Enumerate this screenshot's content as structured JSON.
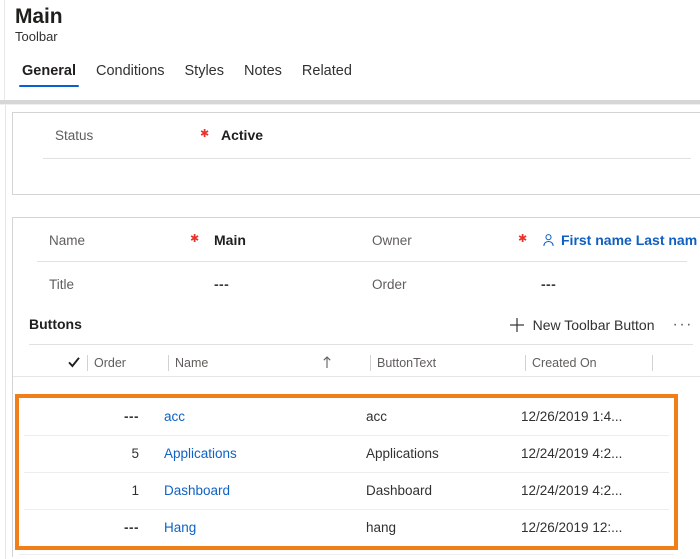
{
  "header": {
    "title": "Main",
    "subtitle": "Toolbar",
    "tabs": [
      {
        "label": "General",
        "active": true
      },
      {
        "label": "Conditions",
        "active": false
      },
      {
        "label": "Styles",
        "active": false
      },
      {
        "label": "Notes",
        "active": false
      },
      {
        "label": "Related",
        "active": false
      }
    ]
  },
  "status_card": {
    "label": "Status",
    "required_marker": "✱",
    "value": "Active"
  },
  "main_card": {
    "rows": [
      {
        "left_label": "Name",
        "left_required": "✱",
        "left_value": "Main",
        "right_label": "Owner",
        "right_required": "✱",
        "right_value": "First name Last nam",
        "right_icon": "person-icon"
      },
      {
        "left_label": "Title",
        "left_required": "",
        "left_value": "---",
        "right_label": "Order",
        "right_required": "",
        "right_value": "---",
        "right_icon": ""
      }
    ]
  },
  "subgrid": {
    "title": "Buttons",
    "new_button_label": "New Toolbar Button",
    "plus_icon": "plus-icon",
    "overflow_label": "···",
    "columns": [
      {
        "label": "Order"
      },
      {
        "label": "Name"
      },
      {
        "label": "ButtonText"
      },
      {
        "label": "Created On"
      }
    ],
    "select_all_icon": "checkmark-icon",
    "sort_icon": "sort-ascending-arrow-icon",
    "rows": [
      {
        "order": "---",
        "name": "acc",
        "button_text": "acc",
        "created_on": "12/26/2019 1:4..."
      },
      {
        "order": "5",
        "name": "Applications",
        "button_text": "Applications",
        "created_on": "12/24/2019 4:2..."
      },
      {
        "order": "1",
        "name": "Dashboard",
        "button_text": "Dashboard",
        "created_on": "12/24/2019 4:2..."
      },
      {
        "order": "---",
        "name": "Hang",
        "button_text": "hang",
        "created_on": "12/26/2019 12:..."
      }
    ]
  },
  "colors": {
    "accent_blue": "#0b5fd4",
    "link_blue": "#0f62c4",
    "highlight_orange": "#f07f1a",
    "required_red": "#e8332a",
    "border_grey": "#d4d4d4"
  }
}
